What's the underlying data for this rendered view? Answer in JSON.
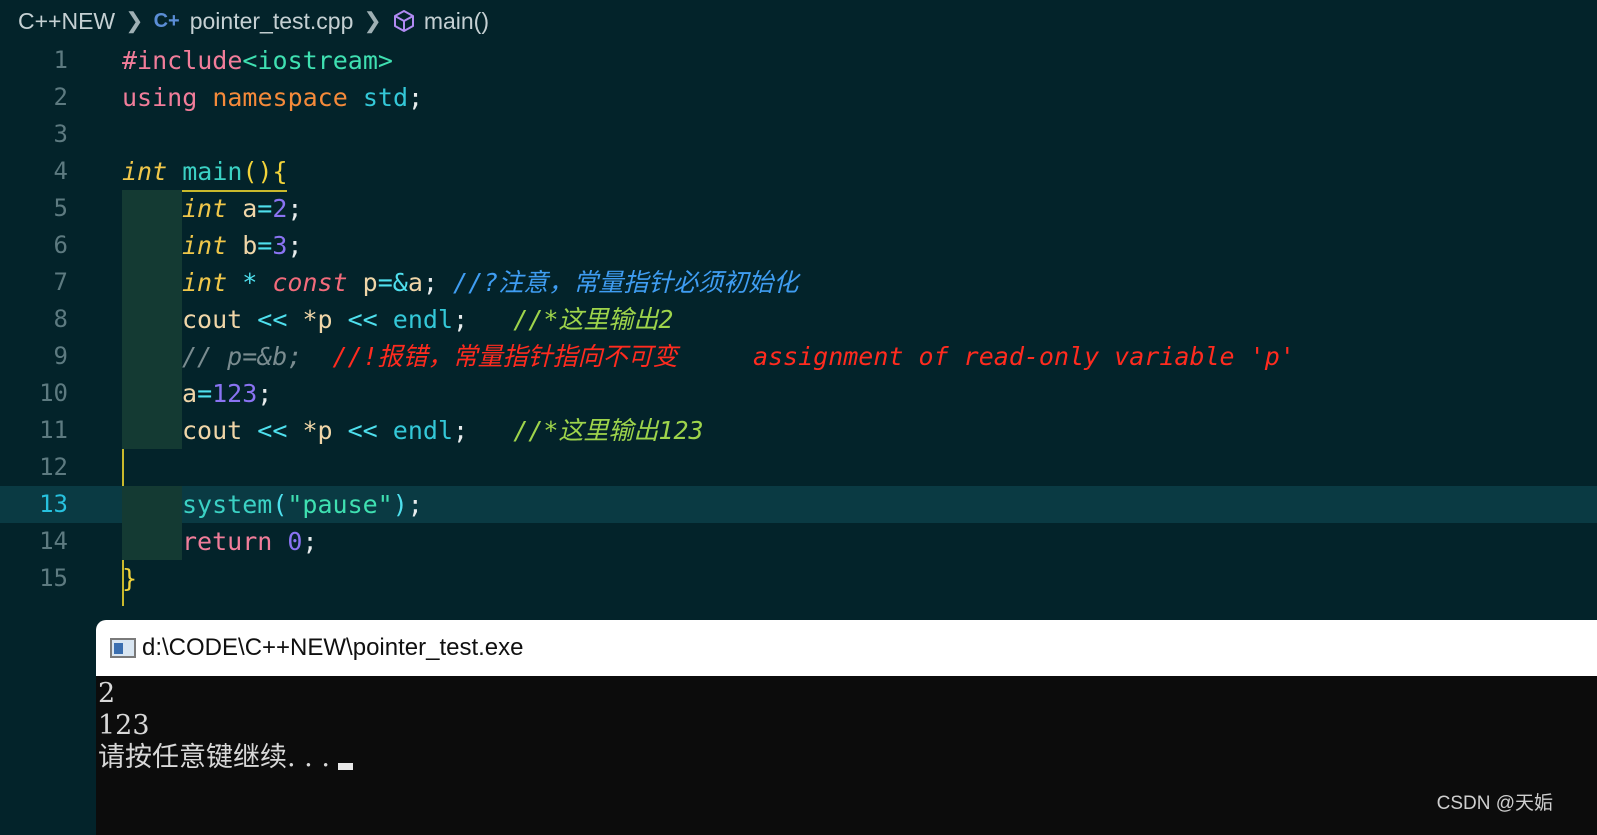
{
  "breadcrumb": {
    "folder": "C++NEW",
    "file": "pointer_test.cpp",
    "symbol": "main()",
    "file_icon": "cpp-icon",
    "symbol_icon": "cube-icon"
  },
  "editor": {
    "active_line": 13,
    "line_numbers": [
      "1",
      "2",
      "3",
      "4",
      "5",
      "6",
      "7",
      "8",
      "9",
      "10",
      "11",
      "12",
      "13",
      "14",
      "15"
    ],
    "lines": {
      "l1": {
        "include": "#include",
        "header": "<iostream>"
      },
      "l2": {
        "using": "using",
        "namespace": "namespace",
        "std": "std",
        "semi": ";"
      },
      "l4": {
        "type": "int",
        "name": "main",
        "parens": "()",
        "brace": "{"
      },
      "l5": {
        "type": "int",
        "var": "a",
        "eq": "=",
        "num": "2",
        "semi": ";"
      },
      "l6": {
        "type": "int",
        "var": "b",
        "eq": "=",
        "num": "3",
        "semi": ";"
      },
      "l7": {
        "type": "int",
        "star": "*",
        "qual": "const",
        "var": "p",
        "eq": "=",
        "amp": "&",
        "ref": "a",
        "semi": ";",
        "comment": "//?注意，常量指针必须初始化"
      },
      "l8": {
        "cout": "cout",
        "op1": "<<",
        "deref": "*p",
        "op2": "<<",
        "endl": "endl",
        "semi": ";",
        "comment": "//*这里输出2"
      },
      "l9": {
        "comment": "// p=&b;",
        "error": "//!报错，常量指针指向不可变",
        "message": "assignment of read-only variable 'p'"
      },
      "l10": {
        "var": "a",
        "eq": "=",
        "num": "123",
        "semi": ";"
      },
      "l11": {
        "cout": "cout",
        "op1": "<<",
        "deref": "*p",
        "op2": "<<",
        "endl": "endl",
        "semi": ";",
        "comment": "//*这里输出123"
      },
      "l13": {
        "fn": "system",
        "open": "(",
        "str": "\"pause\"",
        "close": ")",
        "semi": ";"
      },
      "l14": {
        "kw": "return",
        "num": "0",
        "semi": ";"
      },
      "l15": {
        "brace": "}"
      }
    }
  },
  "console": {
    "title": "d:\\CODE\\C++NEW\\pointer_test.exe",
    "icon": "console-window-icon",
    "output": [
      "2",
      "123",
      "请按任意键继续. . ."
    ]
  },
  "watermark": "CSDN @天姤"
}
